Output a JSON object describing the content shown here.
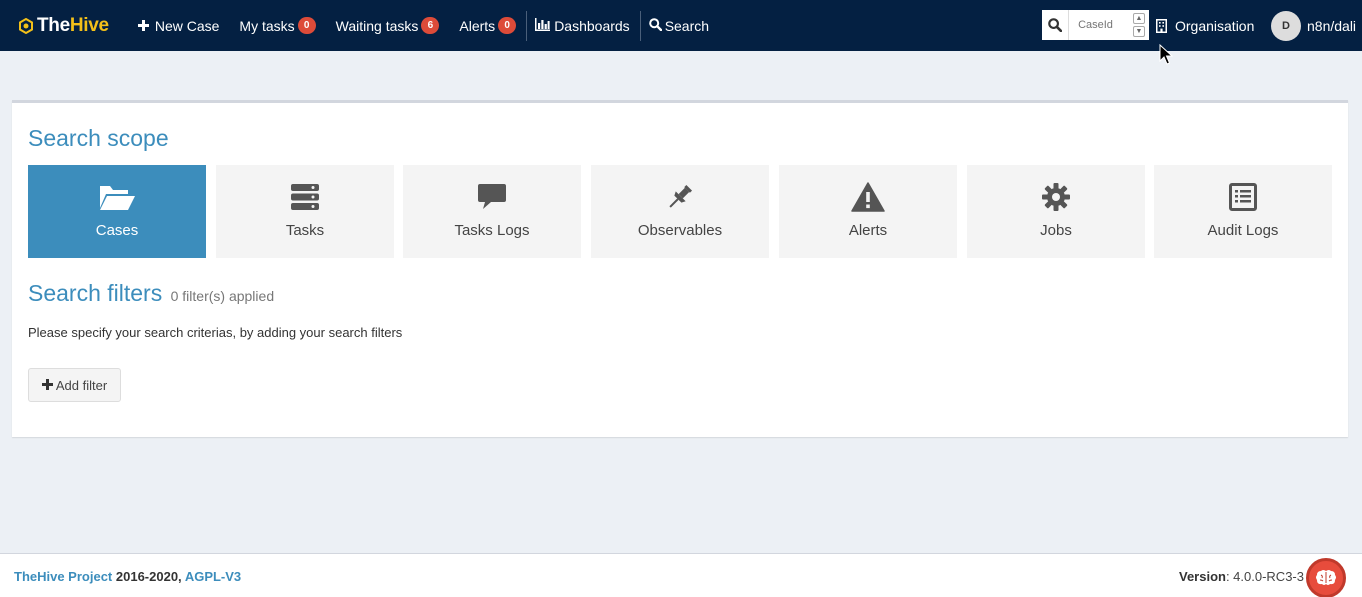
{
  "brand": {
    "the": "The",
    "hive": "Hive"
  },
  "nav": {
    "new_case": "New Case",
    "my_tasks": "My tasks",
    "my_tasks_count": "0",
    "waiting_tasks": "Waiting tasks",
    "waiting_tasks_count": "6",
    "alerts": "Alerts",
    "alerts_count": "0",
    "dashboards": "Dashboards",
    "search": "Search",
    "caseid_placeholder": "CaseId",
    "organisation": "Organisation",
    "avatar_initial": "D",
    "user": "n8n/dali"
  },
  "search_scope": {
    "title": "Search scope",
    "tiles": [
      {
        "label": "Cases",
        "icon": "folder-open-icon",
        "active": true
      },
      {
        "label": "Tasks",
        "icon": "tasks-stack-icon",
        "active": false
      },
      {
        "label": "Tasks Logs",
        "icon": "comment-icon",
        "active": false
      },
      {
        "label": "Observables",
        "icon": "pushpin-icon",
        "active": false
      },
      {
        "label": "Alerts",
        "icon": "warning-icon",
        "active": false
      },
      {
        "label": "Jobs",
        "icon": "gear-icon",
        "active": false
      },
      {
        "label": "Audit Logs",
        "icon": "list-alt-icon",
        "active": false
      }
    ]
  },
  "search_filters": {
    "title": "Search filters",
    "applied": "0 filter(s) applied",
    "hint": "Please specify your search criterias, by adding your search filters",
    "add_filter": "Add filter"
  },
  "footer": {
    "project": "TheHive Project",
    "years": "2016-2020,",
    "license": "AGPL-V3",
    "version_label": "Version",
    "version": ": 4.0.0-RC3-3"
  },
  "colors": {
    "navbar": "#042042",
    "accent": "#3c8dbc",
    "badge": "#dd4b39",
    "brand_yellow": "#f3c019"
  }
}
